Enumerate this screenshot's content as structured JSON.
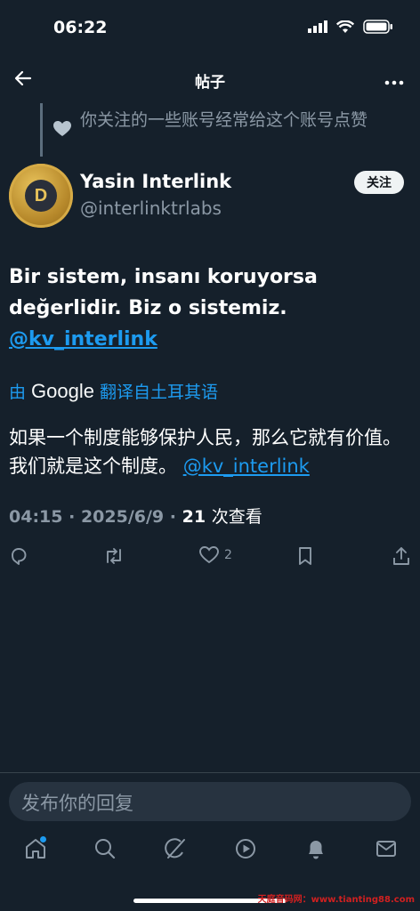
{
  "status_bar": {
    "time": "06:22"
  },
  "header": {
    "title": "帖子"
  },
  "social_context": {
    "text": "你关注的一些账号经常给这个账号点赞"
  },
  "author": {
    "display_name": "Yasin Interlink",
    "handle": "@interlinktrlabs",
    "follow_label": "关注"
  },
  "post": {
    "text_lines": [
      "Bir sistem, insanı koruyorsa",
      "değerlidir. Biz o sistemiz."
    ],
    "mention": "@kv_interlink"
  },
  "translation": {
    "by": "由",
    "provider": "Google",
    "action": "翻译自土耳其语",
    "text": "如果一个制度能够保护人民，那么它就有价值。我们就是这个制度。",
    "mention": "@kv_interlink"
  },
  "meta": {
    "time": "04:15",
    "date": "2025/6/9",
    "views_count": "21",
    "views_label": "次查看",
    "sep": "·"
  },
  "actions": {
    "like_count": "2"
  },
  "reply": {
    "placeholder": "发布你的回复"
  },
  "tabbar": {
    "items": [
      "home-icon",
      "search-icon",
      "grok-icon",
      "video-icon",
      "notifications-icon",
      "messages-icon"
    ]
  },
  "watermark": {
    "text": "天庭音码网：www.tianting88.com"
  },
  "colors": {
    "background": "#15202b",
    "accent": "#1d9bf0",
    "muted": "#8b98a5"
  }
}
